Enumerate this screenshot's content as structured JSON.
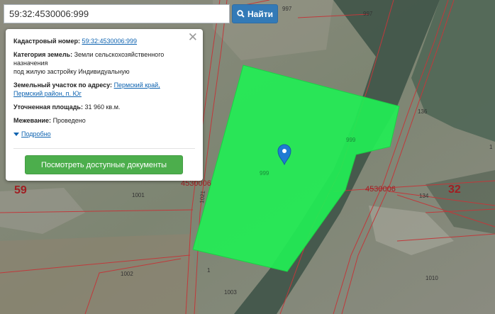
{
  "search": {
    "value": "59:32:4530006:999",
    "button_label": "Найти"
  },
  "popup": {
    "cadastral_label": "Кадастровый номер:",
    "cadastral_value": "59:32:4530006:999",
    "category_label": "Категория земель:",
    "category_value_line1": "Земли сельскохозяйственного",
    "category_value_line2": "назначения",
    "category_value_line3": "под жилую застройку Индивидуальную",
    "address_label": "Земельный участок по адресу:",
    "address_value_part1": "Пермский край,",
    "address_value_part2": "Пермский район, п. Юг",
    "area_label": "Уточненная площадь:",
    "area_value": "31 960 кв.м.",
    "survey_label": "Межевание:",
    "survey_value": "Проведено",
    "more_link": "Подробно",
    "docs_button": "Посмотреть доступные документы"
  },
  "map_labels": {
    "l_997a": "997",
    "l_997b": "997",
    "l_136": "136",
    "l_999a": "999",
    "l_999b": "999",
    "l_4530006": "4530006",
    "l_134": "134",
    "l_32": "32",
    "l_59": "59",
    "l_45300": "4530006",
    "l_1021": "1021",
    "l_1001": "1001",
    "l_1002": "1002",
    "l_1003": "1003",
    "l_1010": "1010",
    "l_1a": "1",
    "l_1b": "1"
  },
  "colors": {
    "parcel_fill": "#22ee55",
    "boundary": "#c0393b",
    "label_dark_red": "#a01e22",
    "marker": "#1f7bd3"
  }
}
